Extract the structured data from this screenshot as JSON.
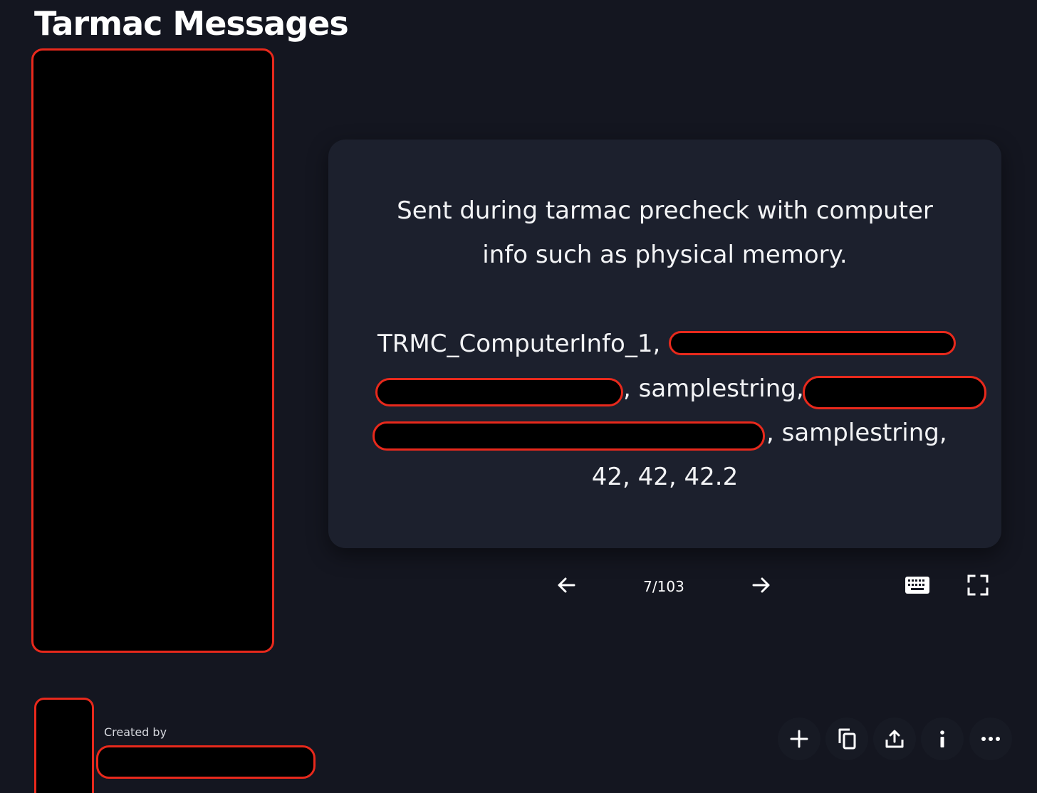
{
  "header": {
    "title": "Tarmac Messages"
  },
  "card": {
    "line1": "Sent during tarmac precheck with computer",
    "line2": "info such as physical memory.",
    "params_line1_prefix": "TRMC_ComputerInfo_1,",
    "params_line2_middle": ", samplestring,",
    "params_line3_suffix": ", samplestring,",
    "params_line4": "42, 42, 42.2"
  },
  "navigation": {
    "counter": "7/103"
  },
  "footer": {
    "created_by_label": "Created by"
  },
  "icons": {
    "prev": "arrow-left-icon",
    "next": "arrow-right-icon",
    "keyboard": "keyboard-icon",
    "fullscreen": "fullscreen-icon",
    "add": "plus-icon",
    "copy": "copy-icon",
    "share": "share-icon",
    "info": "info-icon",
    "more": "more-icon"
  },
  "colors": {
    "background": "#141620",
    "card": "#1c202d",
    "redaction_border": "#e8291c"
  }
}
